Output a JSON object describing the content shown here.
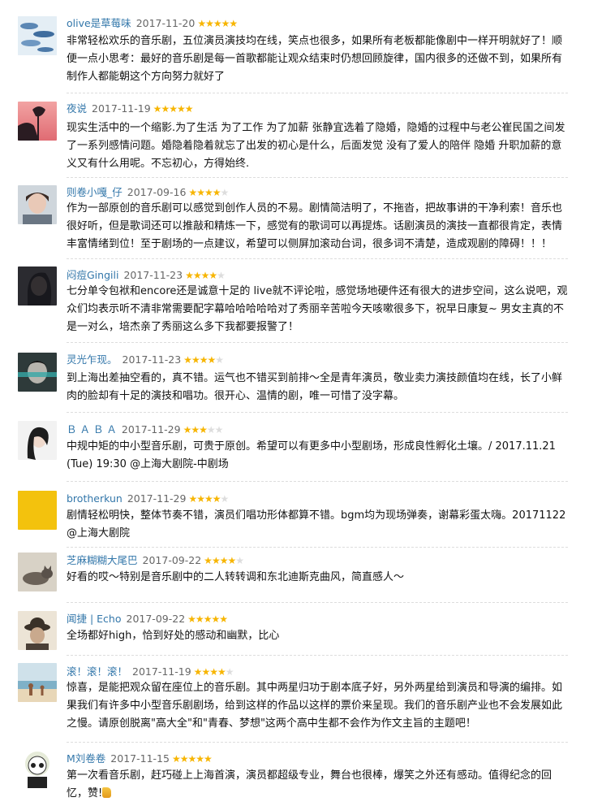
{
  "reviews": [
    {
      "author": "olive是草莓味",
      "date": "2017-11-20",
      "rating": 5,
      "text": "非常轻松欢乐的音乐剧，五位演员演技均在线，笑点也很多，如果所有老板都能像剧中一样开明就好了！顺便一点小思考：最好的音乐剧是每一首歌都能让观众结束时仍想回顾旋律，国内很多的还做不到，如果所有制作人都能朝这个方向努力就好了"
    },
    {
      "author": "夜说",
      "date": "2017-11-19",
      "rating": 5,
      "text": "现实生活中的一个缩影.为了生活 为了工作 为了加薪 张静宜选着了隐婚，隐婚的过程中与老公崔民国之间发了一系列感情问题。婚隐着隐着就忘了出发的初心是什么，后面发觉 没有了爱人的陪伴 隐婚 升职加薪的意义又有什么用呢。不忘初心，方得始终."
    },
    {
      "author": "则卷小嘎_仔",
      "date": "2017-09-16",
      "rating": 4,
      "text": "作为一部原创的音乐剧可以感觉到创作人员的不易。剧情简洁明了，不拖沓，把故事讲的干净利索！音乐也很好听，但是歌词还可以推敲和精炼一下，感觉有的歌词可以再提炼。话剧演员的演技一直都很肯定，表情丰富情绪到位！至于剧场的一点建议，希望可以侧屏加滚动台词，很多词不清楚，造成观剧的障碍！！！"
    },
    {
      "author": "闷痘Gingili",
      "date": "2017-11-23",
      "rating": 4,
      "text": "七分单令包袱和encore还是诚意十足的 live就不评论啦，感觉场地硬件还有很大的进步空间，这么说吧，观众们均表示听不清非常需要配字幕哈哈哈哈哈对了秀丽辛苦啦今天咳嗽很多下，祝早日康复~ 男女主真的不是一对么，培杰亲了秀丽这么多下我都要报警了！"
    },
    {
      "author": "灵光乍现。",
      "date": "2017-11-23",
      "rating": 4,
      "text": "到上海出差抽空看的，真不错。运气也不错买到前排～全是青年演员，敬业卖力演技颜值均在线，长了小鲜肉的脸却有十足的演技和唱功。很开心、温情的剧，唯一可惜了没字幕。"
    },
    {
      "author": "Ｂ Ａ Ｂ Ａ",
      "date": "2017-11-29",
      "rating": 3,
      "text": "中规中矩的中小型音乐剧，可贵于原创。希望可以有更多中小型剧场，形成良性孵化土壤。/ 2017.11.21 (Tue) 19:30 @上海大剧院-中剧场"
    },
    {
      "author": "brotherkun",
      "date": "2017-11-29",
      "rating": 4,
      "text": "剧情轻松明快，整体节奏不错，演员们唱功形体都算不错。bgm均为现场弹奏，谢幕彩蛋太嗨。20171122@上海大剧院"
    },
    {
      "author": "芝麻糊糊大尾巴",
      "date": "2017-09-22",
      "rating": 4,
      "text": "好看的哎～特别是音乐剧中的二人转转调和东北迪斯克曲风，简直感人～"
    },
    {
      "author": "闻捷 | Echo",
      "date": "2017-09-22",
      "rating": 5,
      "text": "全场都好high，恰到好处的感动和幽默，比心"
    },
    {
      "author": "滚！滚！滚！",
      "date": "2017-11-19",
      "rating": 4,
      "text": "惊喜，是能把观众留在座位上的音乐剧。其中两星归功于剧本底子好，另外两星给到演员和导演的编排。如果我们有许多中小型音乐剧剧场，给到这样的作品以这样的票价来呈现。我们的音乐剧产业也不会发展如此之慢。请原创脱离\"高大全\"和\"青春、梦想\"这两个高中生都不会作为作文主旨的主题吧！"
    },
    {
      "author": "M刘卷卷",
      "date": "2017-11-15",
      "rating": 5,
      "text": "第一次看音乐剧，赶巧碰上上海首演，演员都超级专业，舞台也很棒，爆笑之外还有感动。值得纪念的回忆，赞!"
    }
  ],
  "star_on_color": "#f7b500",
  "star_off_color": "#dddddd",
  "link_color": "#3377aa"
}
